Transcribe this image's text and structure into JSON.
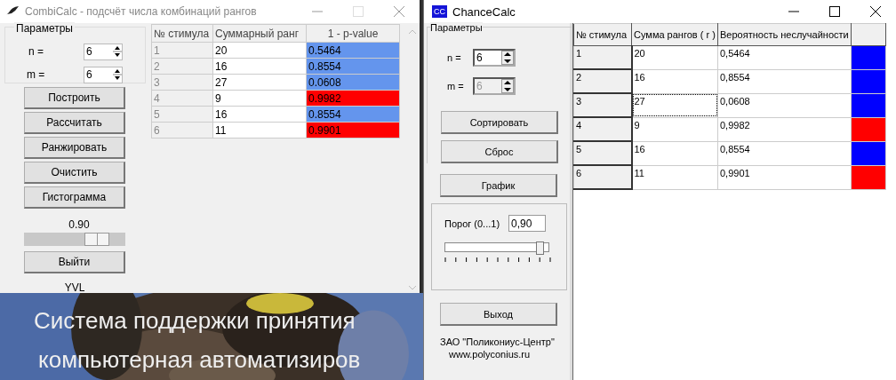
{
  "background": {
    "kind": "picture",
    "caption_lines": [
      "Система поддержки принятия",
      "компьютерная автоматизиров"
    ]
  },
  "combicalc": {
    "title": "CombiCalc - подсчёт числа комбинаций рангов",
    "active": false,
    "params_title": "Параметры",
    "params": [
      {
        "label": "n =",
        "value": "6",
        "disabled": false
      },
      {
        "label": "m =",
        "value": "6",
        "disabled": false
      }
    ],
    "buttons": [
      "Построить",
      "Рассчитать",
      "Ранжировать",
      "Очистить",
      "Гистограмма"
    ],
    "threshold": "0.90",
    "slider": {
      "level": 0.72
    },
    "exit_button": "Выйти",
    "author": "YVL",
    "table": {
      "columns": [
        "№ стимула",
        "Суммарный ранг",
        "1 - p-value"
      ],
      "rows": [
        {
          "cells": [
            "1",
            "20",
            "0.5464"
          ],
          "color": "#6495ed"
        },
        {
          "cells": [
            "2",
            "16",
            "0.8554"
          ],
          "color": "#6495ed"
        },
        {
          "cells": [
            "3",
            "27",
            "0.0608"
          ],
          "color": "#6495ed"
        },
        {
          "cells": [
            "4",
            "9",
            "0.9982"
          ],
          "color": "#ff0000"
        },
        {
          "cells": [
            "5",
            "16",
            "0.8554"
          ],
          "color": "#6495ed"
        },
        {
          "cells": [
            "6",
            "11",
            "0.9901"
          ],
          "color": "#ff0000"
        }
      ]
    }
  },
  "chancecalc": {
    "title": "ChanceCalc",
    "icon_text": "CC",
    "active": true,
    "params_title": "Параметры",
    "params": [
      {
        "label": "n =",
        "value": "6",
        "disabled": false
      },
      {
        "label": "m =",
        "value": "6",
        "disabled": true
      }
    ],
    "buttons": [
      "Сортировать",
      "Сброс"
    ],
    "chart_button": "График",
    "threshold_label": "Порог (0...1)",
    "threshold_value": "0,90",
    "slider": {
      "level": 0.92
    },
    "exit_button": "Выход",
    "company": "ЗАО \"Поликониус-Центр\"",
    "website": "www.polyconius.ru",
    "table": {
      "columns": [
        "№ стимула",
        "Сумма рангов ( r )",
        "Вероятность неслучайности"
      ],
      "rows": [
        {
          "cells": [
            "1",
            "20",
            "0,5464"
          ],
          "color": "#0000ff",
          "focused": false
        },
        {
          "cells": [
            "2",
            "16",
            "0,8554"
          ],
          "color": "#0000ff",
          "focused": false
        },
        {
          "cells": [
            "3",
            "27",
            "0,0608"
          ],
          "color": "#0000ff",
          "focused": true
        },
        {
          "cells": [
            "4",
            "9",
            "0,9982"
          ],
          "color": "#ff0000",
          "focused": false
        },
        {
          "cells": [
            "5",
            "16",
            "0,8554"
          ],
          "color": "#0000ff",
          "focused": false
        },
        {
          "cells": [
            "6",
            "11",
            "0,9901"
          ],
          "color": "#ff0000",
          "focused": false
        }
      ]
    }
  }
}
